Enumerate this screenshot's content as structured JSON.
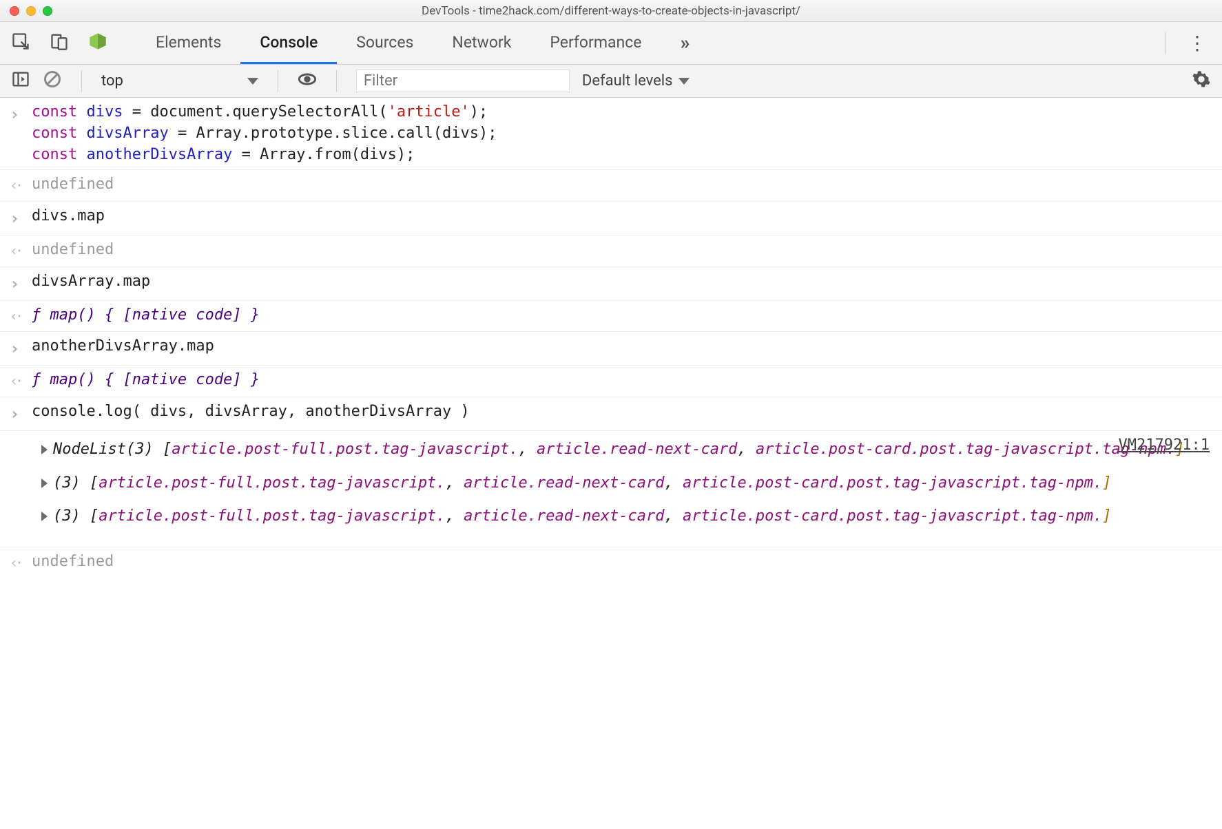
{
  "window": {
    "title": "DevTools - time2hack.com/different-ways-to-create-objects-in-javascript/"
  },
  "tabs": {
    "items": [
      "Elements",
      "Console",
      "Sources",
      "Network",
      "Performance"
    ],
    "active": "Console"
  },
  "subtoolbar": {
    "context": "top",
    "filter_placeholder": "Filter",
    "levels": "Default levels"
  },
  "console_rows": {
    "r0": {
      "code_html": "<span class='kw'>const</span> <span class='ident'>divs</span> = document.querySelectorAll(<span class='str'>'article'</span>);<br><span class='kw'>const</span> <span class='ident'>divsArray</span> = Array.prototype.slice.call(divs);<br><span class='kw'>const</span> <span class='ident'>anotherDivsArray</span> = Array.from(divs);"
    },
    "r1": {
      "text": "undefined"
    },
    "r2": {
      "text": "divs.map"
    },
    "r3": {
      "text": "undefined"
    },
    "r4": {
      "text": "divsArray.map"
    },
    "r5_fn": "ƒ map() { [native code] }",
    "r6": {
      "text": "anotherDivsArray.map"
    },
    "r7_fn": "ƒ map() { [native code] }",
    "r8": {
      "text": "console.log( divs, divsArray, anotherDivsArray )"
    },
    "log": {
      "source": "VM217921:1",
      "blocks": [
        {
          "prefix": "NodeList(3) ",
          "items": [
            "article.post-full.post.tag-javascript.",
            "article.read-next-card",
            "article.post-card.post.tag-javascript.tag-npm."
          ]
        },
        {
          "prefix": "(3) ",
          "items": [
            "article.post-full.post.tag-javascript.",
            "article.read-next-card",
            "article.post-card.post.tag-javascript.tag-npm."
          ]
        },
        {
          "prefix": "(3) ",
          "items": [
            "article.post-full.post.tag-javascript.",
            "article.read-next-card",
            "article.post-card.post.tag-javascript.tag-npm."
          ]
        }
      ]
    },
    "r_last": {
      "text": "undefined"
    }
  }
}
